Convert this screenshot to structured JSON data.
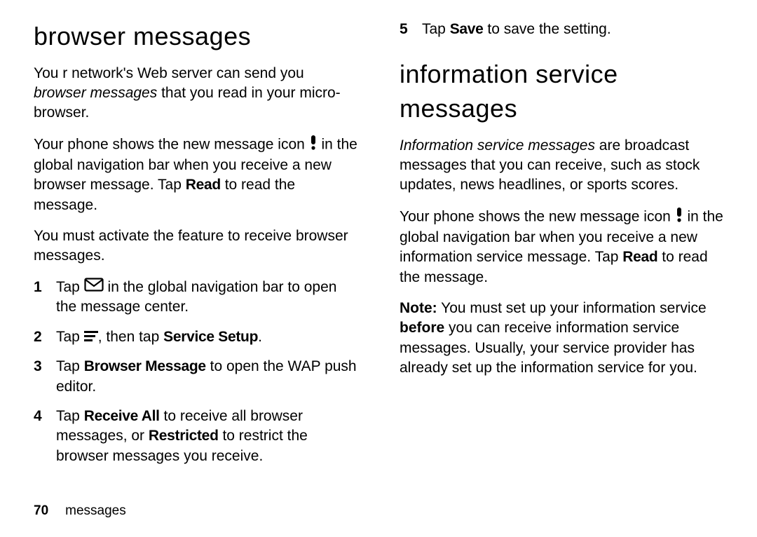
{
  "left": {
    "heading": "browser messages",
    "intro_a": "You r network's Web server can send you ",
    "intro_em": "browser messages",
    "intro_b": " that you read in your micro-browser.",
    "new_msg_a": "Your phone shows the new message icon ",
    "new_msg_b": " in the global navigation bar when you receive a new browser message. Tap ",
    "read_label": "Read",
    "new_msg_c": " to read the message.",
    "activate": "You must activate the feature to receive browser messages.",
    "step1_a": "Tap ",
    "step1_b": " in the global navigation bar to open the message center.",
    "step2_a": "Tap ",
    "step2_b": ", then tap ",
    "service_setup": "Service Setup",
    "step2_c": ".",
    "step3_a": "Tap ",
    "browser_message": "Browser Message",
    "step3_b": " to open the WAP push editor.",
    "step4_a": "Tap ",
    "receive_all": "Receive All",
    "step4_b": " to receive all browser messages, or ",
    "restricted": "Restricted",
    "step4_c": " to restrict the browser messages you receive."
  },
  "right": {
    "step5_a": "Tap ",
    "save": "Save",
    "step5_b": " to save the setting.",
    "heading": "information service messages",
    "intro_em": "Information service messages",
    "intro_a": " are broadcast messages that you can receive, such as stock updates, news headlines, or sports scores.",
    "new_msg_a": "Your phone shows the new message icon ",
    "new_msg_b": " in the global navigation bar when you receive a new information service message. Tap ",
    "read_label": "Read",
    "new_msg_c": " to read the message.",
    "note_label": "Note:",
    "note_a": " You must set up your information service ",
    "note_bold": "before",
    "note_b": " you can receive information service messages. Usually, your service provider has already set up the information service for you."
  },
  "footer": {
    "page_number": "70",
    "section": "messages"
  }
}
